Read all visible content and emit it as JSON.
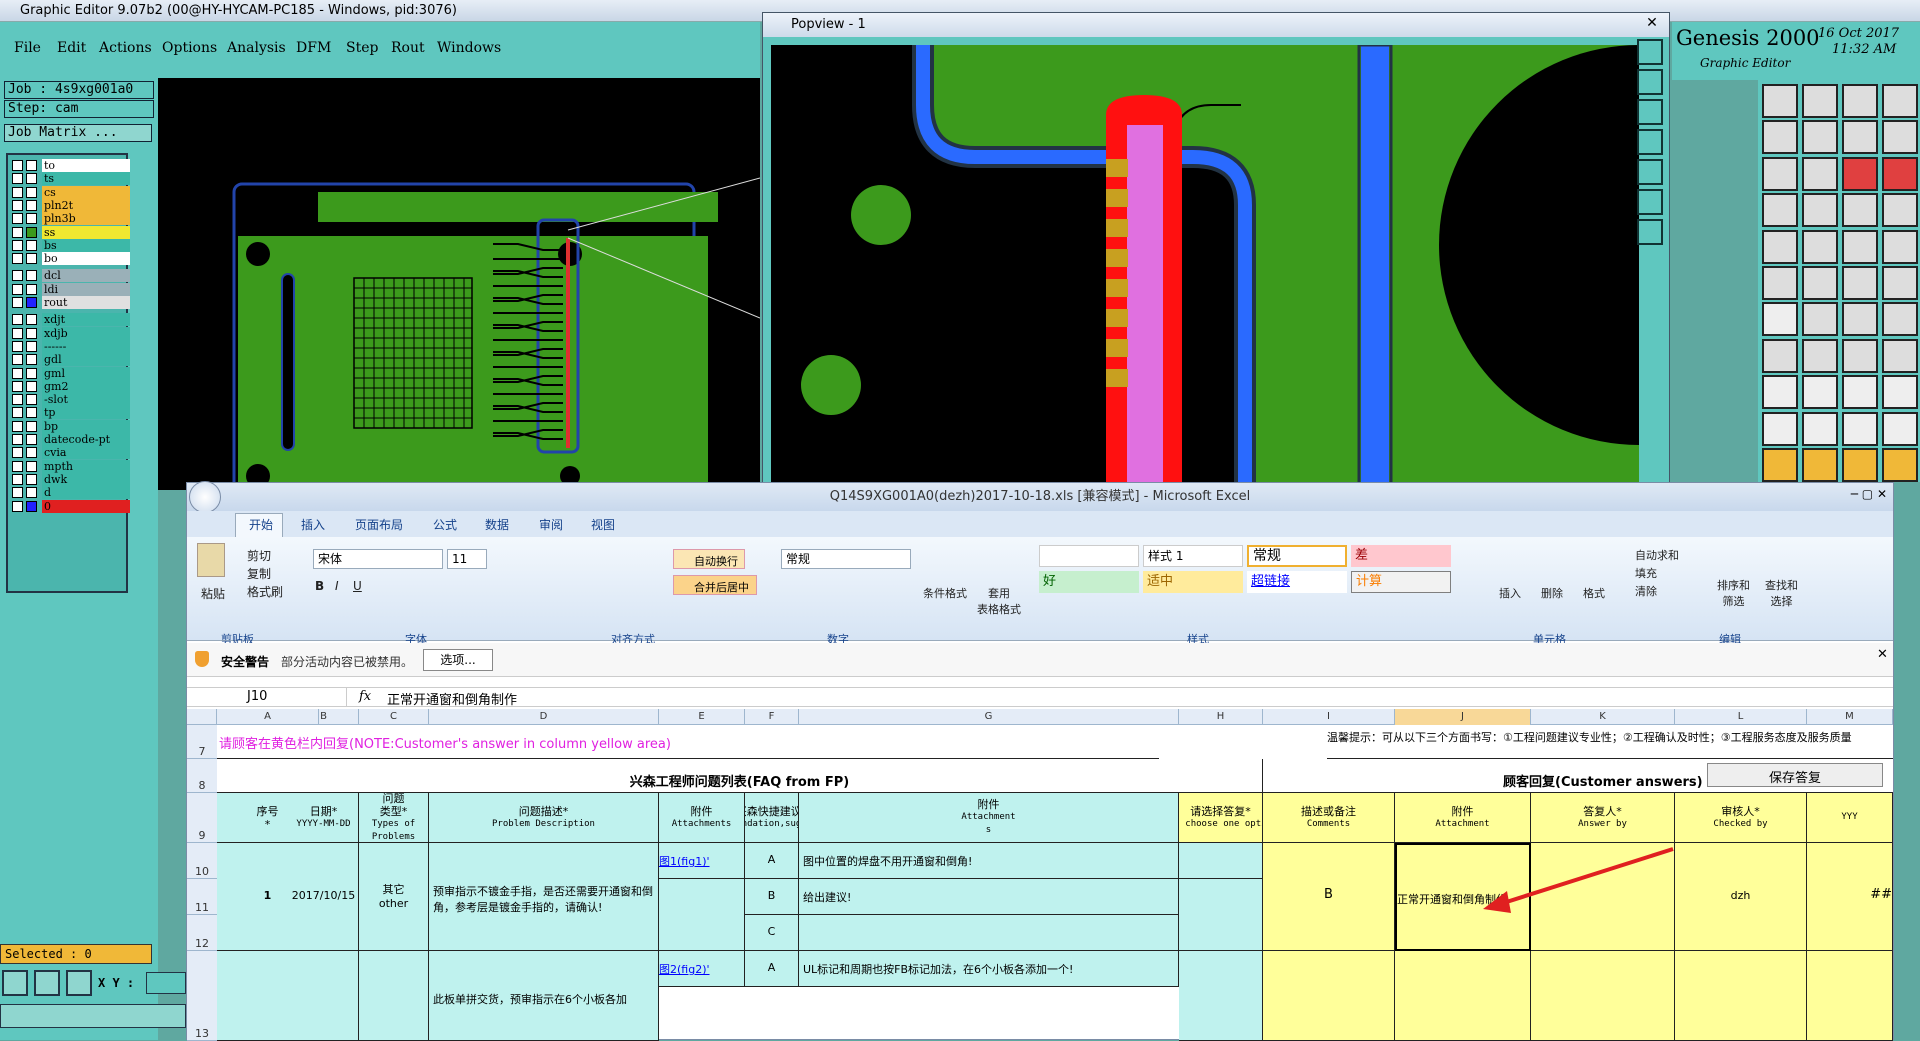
{
  "genesis": {
    "title": "Graphic Editor 9.07b2 (00@HY-HYCAM-PC185 - Windows, pid:3076)",
    "menus": [
      "File",
      "Edit",
      "Actions",
      "Options",
      "Analysis",
      "DFM",
      "Step",
      "Rout",
      "Windows"
    ],
    "job_label": "Job : 4s9xg001a0",
    "step_label": "Step: cam",
    "job_matrix": "Job Matrix ...",
    "layers": [
      {
        "name": "to",
        "color": "#ffffff"
      },
      {
        "name": "ts",
        "color": "#3cb8a8"
      },
      {
        "name": "cs",
        "color": "#f0b838"
      },
      {
        "name": "pln2t",
        "color": "#f0b838"
      },
      {
        "name": "pln3b",
        "color": "#f0b838"
      },
      {
        "name": "ss",
        "color": "#f0e830"
      },
      {
        "name": "bs",
        "color": "#3cb8a8"
      },
      {
        "name": "bo",
        "color": "#ffffff"
      },
      {
        "name": "dcl",
        "color": "#9ab0b8"
      },
      {
        "name": "ldi",
        "color": "#9ab0b8"
      },
      {
        "name": "rout",
        "color": "#e0e0e0"
      },
      {
        "name": "xdjt",
        "color": "#3cb8a8"
      },
      {
        "name": "xdjb",
        "color": "#3cb8a8"
      },
      {
        "name": "------",
        "color": "#3cb8a8"
      },
      {
        "name": "gdl",
        "color": "#3cb8a8"
      },
      {
        "name": "gml",
        "color": "#3cb8a8"
      },
      {
        "name": "gm2",
        "color": "#3cb8a8"
      },
      {
        "name": "-slot",
        "color": "#3cb8a8"
      },
      {
        "name": "tp",
        "color": "#3cb8a8"
      },
      {
        "name": "bp",
        "color": "#3cb8a8"
      },
      {
        "name": "datecode-pt",
        "color": "#3cb8a8"
      },
      {
        "name": "cvia",
        "color": "#3cb8a8"
      },
      {
        "name": "mpth",
        "color": "#3cb8a8"
      },
      {
        "name": "dwk",
        "color": "#3cb8a8"
      },
      {
        "name": "d",
        "color": "#3cb8a8"
      },
      {
        "name": "0",
        "color": "#3cb8a8"
      }
    ],
    "selected": "Selected : 0",
    "xy_label": "X Y :",
    "brand": "Genesis 2000",
    "brand_sub": "Graphic Editor",
    "date": "16 Oct 2017",
    "time": "11:32 AM"
  },
  "popview": {
    "title": "Popview - 1"
  },
  "excel": {
    "title": "Q14S9XG001A0(dezh)2017-10-18.xls [兼容模式] - Microsoft Excel",
    "tabs": [
      "开始",
      "插入",
      "页面布局",
      "公式",
      "数据",
      "审阅",
      "视图"
    ],
    "clipboard": {
      "paste": "粘贴",
      "cut": "剪切",
      "copy": "复制",
      "format_painter": "格式刷",
      "group": "剪贴板"
    },
    "font": {
      "name": "宋体",
      "size": "11",
      "group": "字体"
    },
    "align": {
      "wrap": "自动换行",
      "merge": "合并后居中",
      "group": "对齐方式"
    },
    "number": {
      "format": "常规",
      "group": "数字"
    },
    "styles": {
      "cond": "条件格式",
      "table": "套用\n表格格式",
      "s1": "样式 1",
      "normal": "常规",
      "bad": "差",
      "good": "好",
      "neutral": "适中",
      "hyperlink": "超链接",
      "calc": "计算",
      "group": "样式"
    },
    "cells": {
      "insert": "插入",
      "delete": "删除",
      "format": "格式",
      "group": "单元格"
    },
    "edit": {
      "autosum": "自动求和",
      "fill": "填充",
      "clear": "清除",
      "sort": "排序和\n筛选",
      "find": "查找和\n选择",
      "group": "编辑"
    },
    "security": {
      "title": "安全警告",
      "msg": "部分活动内容已被禁用。",
      "btn": "选项..."
    },
    "namebox": "J10",
    "formula": "正常开通窗和倒角制作",
    "cols": [
      "A",
      "B",
      "C",
      "D",
      "E",
      "F",
      "G",
      "H",
      "I",
      "J",
      "K",
      "L",
      "M"
    ],
    "row7_note": "请顾客在黄色栏内回复(NOTE:Customer's answer in column yellow area)",
    "row7_tip": "温馨提示：可从以下三个方面书写：①工程问题建议专业性；②工程确认及时性；③工程服务态度及服务质量",
    "row8_left": "兴森工程师问题列表(FAQ from FP)",
    "row8_right": "顾客回复(Customer answers)",
    "save_btn": "保存答复",
    "headers": [
      {
        "zh": "序号\n*",
        "en": ""
      },
      {
        "zh": "日期*",
        "en": "YYYY-MM-DD"
      },
      {
        "zh": "问题\n类型*",
        "en": "Types of\nProblems"
      },
      {
        "zh": "问题描述*",
        "en": "Problem Description"
      },
      {
        "zh": "附件",
        "en": "Attachments"
      },
      {
        "zh": "兴森快捷建议*",
        "en": "(Recommendation,suggestion)"
      },
      {
        "zh": "附件",
        "en": "Attachment\ns"
      },
      {
        "zh": "请选择答复*",
        "en": "Pls choose one option"
      },
      {
        "zh": "描述或备注",
        "en": "Comments"
      },
      {
        "zh": "附件",
        "en": "Attachment"
      },
      {
        "zh": "答复人*",
        "en": "Answer by"
      },
      {
        "zh": "审核人*",
        "en": "Checked by"
      },
      {
        "zh": "",
        "en": "YYY"
      }
    ],
    "row1": {
      "no": "1",
      "date": "2017/10/15",
      "type": "其它\nother",
      "desc": "预审指示不镀金手指，是否还需要开通窗和倒角，参考层是镀金手指的，请确认!",
      "att": "图1(fig1)'",
      "optA": "A",
      "optB": "B",
      "optC": "C",
      "sugA": "图中位置的焊盘不用开通窗和倒角!",
      "sugB": "给出建议!",
      "answer": "B",
      "comment": "正常开通窗和倒角制作",
      "by": "dzh",
      "chk": "##"
    },
    "row2": {
      "att": "图2(fig2)'",
      "optA": "A",
      "sugA": "UL标记和周期也按FB标记加法，在6个小板各添加一个!",
      "desc": "此板单拼交货，预审指示在6个小板各加"
    },
    "row_nums": [
      "7",
      "8",
      "9",
      "10",
      "11",
      "12",
      "13"
    ]
  }
}
